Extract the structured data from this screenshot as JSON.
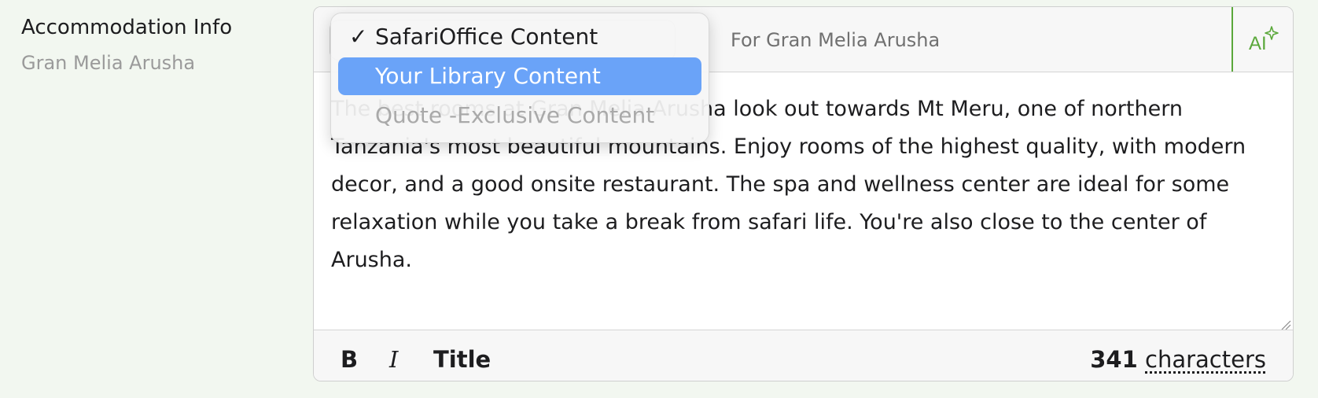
{
  "field": {
    "label": "Accommodation Info",
    "sublabel": "Gran Melia Arusha"
  },
  "editor": {
    "header": {
      "for_text": "For Gran Melia Arusha",
      "ai_label": "AI"
    },
    "body_text": "The best rooms at Gran Melia Arusha look out towards Mt Meru, one of northern Tanzania's most beautiful mountains. Enjoy rooms of the highest quality, with modern decor, and a good onsite restaurant. The spa and wellness center are ideal for some relaxation while you take a break from safari life. You're also close to the center of Arusha.",
    "toolbar": {
      "bold_label": "B",
      "italic_label": "I",
      "title_label": "Title"
    },
    "char_count": {
      "number": "341",
      "unit": "characters"
    }
  },
  "dropdown": {
    "options": [
      {
        "label": "SafariOffice Content",
        "checked": true,
        "state": "selected"
      },
      {
        "label": "Your Library Content",
        "checked": false,
        "state": "highlighted"
      },
      {
        "label": "Quote -Exclusive Content",
        "checked": false,
        "state": "disabled"
      }
    ],
    "check_mark": "✓"
  },
  "colors": {
    "page_background": "#f2f7f0",
    "highlight": "#6aa3f8",
    "ai_accent": "#5aa83a"
  }
}
